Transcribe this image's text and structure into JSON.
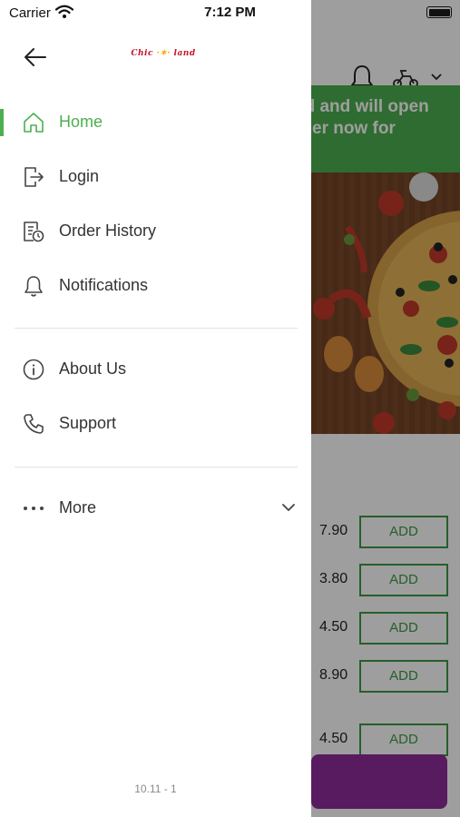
{
  "status_bar": {
    "carrier": "Carrier",
    "time": "7:12 PM"
  },
  "drawer": {
    "logo_text_left": "Chic",
    "logo_text_right": "land",
    "menu": [
      {
        "label": "Home",
        "icon": "home-icon",
        "active": true
      },
      {
        "label": "Login",
        "icon": "login-icon"
      },
      {
        "label": "Order History",
        "icon": "order-history-icon"
      },
      {
        "label": "Notifications",
        "icon": "bell-icon"
      },
      {
        "label": "About Us",
        "icon": "info-icon"
      },
      {
        "label": "Support",
        "icon": "phone-icon"
      },
      {
        "label": "More",
        "icon": "more-dots-icon"
      }
    ],
    "version": "10.11 - 1"
  },
  "background": {
    "banner_lines": [
      "ed and will open",
      "rder now for"
    ],
    "items": [
      {
        "price": "7.90",
        "add": "ADD"
      },
      {
        "price": "3.80",
        "add": "ADD"
      },
      {
        "price": "4.50",
        "add": "ADD"
      },
      {
        "price": "8.90",
        "add": "ADD"
      },
      {
        "price": "4.50",
        "add": "ADD"
      }
    ]
  },
  "colors": {
    "accent": "#4caf50",
    "checkout": "#8e2c9a",
    "logo_red": "#c8102e"
  }
}
